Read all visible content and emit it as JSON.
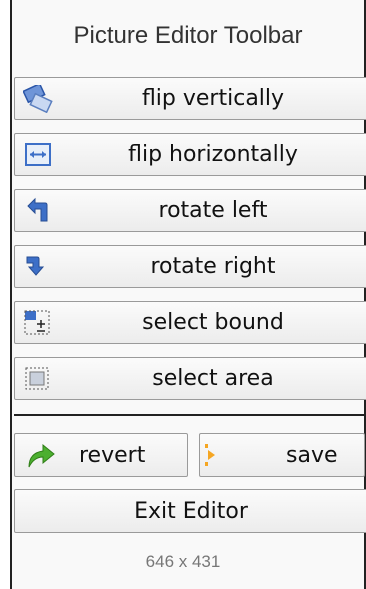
{
  "toolbar": {
    "title": "Picture Editor Toolbar",
    "tools": [
      {
        "label": "flip vertically",
        "icon": "flip-vertical-icon"
      },
      {
        "label": "flip horizontally",
        "icon": "flip-horizontal-icon"
      },
      {
        "label": "rotate left",
        "icon": "rotate-left-icon"
      },
      {
        "label": "rotate right",
        "icon": "rotate-right-icon"
      },
      {
        "label": "select bound",
        "icon": "select-bound-icon"
      },
      {
        "label": "select area",
        "icon": "select-area-icon"
      }
    ],
    "revert_label": "revert",
    "revert_icon": "revert-arrow-icon",
    "save_label": "save",
    "save_icon": "save-icon",
    "exit_label": "Exit Editor",
    "dimensions": "646 x 431"
  },
  "colors": {
    "icon_blue": "#3d6fc7",
    "revert_green": "#4caf2f",
    "save_orange": "#f5a623"
  }
}
